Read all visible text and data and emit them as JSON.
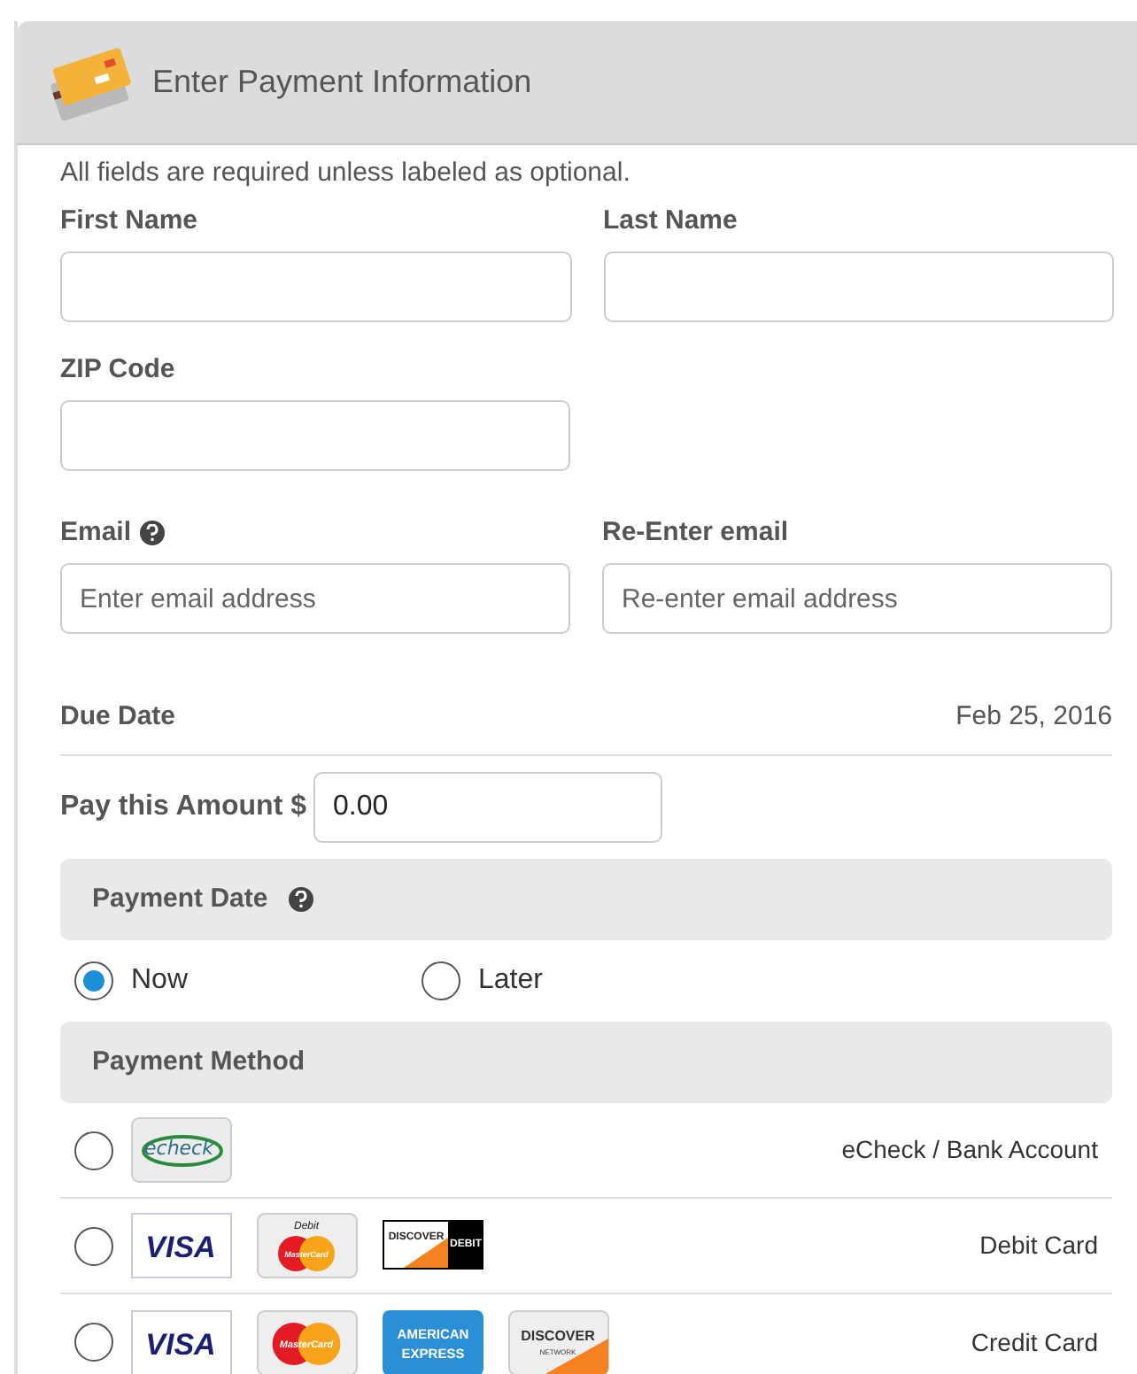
{
  "header": {
    "title": "Enter Payment Information"
  },
  "notice": "All fields are required unless labeled as optional.",
  "fields": [
    {
      "label": "First Name",
      "help": false
    },
    {
      "label": "Last Name",
      "help": false
    },
    {
      "label": "ZIP Code",
      "help": false
    },
    {
      "label": "Email",
      "placeholder": "Enter email address",
      "help": true
    },
    {
      "label": "Re-Enter email",
      "placeholder": "Re-enter email address",
      "help": false
    }
  ],
  "due_date": {
    "label": "Due Date",
    "value": "Feb 25, 2016"
  },
  "amount": {
    "label": "Pay this Amount $",
    "value": "0.00"
  },
  "payment_date": {
    "title": "Payment Date",
    "help": true,
    "options": [
      {
        "label": "Now",
        "selected": true
      },
      {
        "label": "Later",
        "selected": false
      }
    ]
  },
  "payment_method": {
    "title": "Payment Method",
    "options": [
      {
        "label": "eCheck / Bank Account",
        "selected": false,
        "logos": [
          {
            "kind": "echeck",
            "text": "echeck"
          }
        ]
      },
      {
        "label": "Debit Card",
        "selected": false,
        "logos": [
          {
            "kind": "visa",
            "text": "VISA"
          },
          {
            "kind": "mastercard_debit",
            "text": "MasterCard",
            "top": "Debit"
          },
          {
            "kind": "discover_debit",
            "text": "DISCOVER",
            "side": "DEBIT"
          }
        ]
      },
      {
        "label": "Credit Card",
        "selected": false,
        "logos": [
          {
            "kind": "visa",
            "text": "VISA"
          },
          {
            "kind": "mastercard",
            "text": "MasterCard"
          },
          {
            "kind": "amex",
            "text": "AMERICAN",
            "side": "EXPRESS"
          },
          {
            "kind": "discover",
            "text": "DISCOVER",
            "side": "NETWORK"
          }
        ]
      }
    ]
  }
}
